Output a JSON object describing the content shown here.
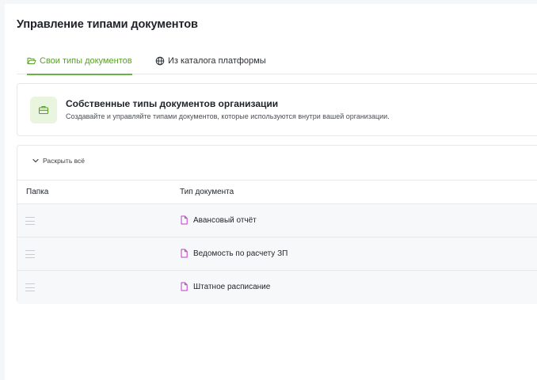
{
  "page": {
    "title": "Управление типами документов"
  },
  "tabs": [
    {
      "label": "Свои типы документов",
      "icon": "folder-open-icon",
      "active": true
    },
    {
      "label": "Из каталога платформы",
      "icon": "globe-icon",
      "active": false
    }
  ],
  "info": {
    "icon": "briefcase-icon",
    "title": "Собственные типы документов организации",
    "subtitle": "Создавайте и управляйте типами документов, которые используются внутри вашей организации."
  },
  "table": {
    "expand_label": "Раскрыть всё",
    "columns": [
      "Папка",
      "Тип документа"
    ],
    "rows": [
      {
        "document_type": "Авансовый отчёт"
      },
      {
        "document_type": "Ведомость по расчету ЗП"
      },
      {
        "document_type": "Штатное расписание"
      }
    ]
  },
  "colors": {
    "accent": "#6ab04c",
    "doc_icon": "#c040c8",
    "icon_bg": "#e9f5df"
  }
}
